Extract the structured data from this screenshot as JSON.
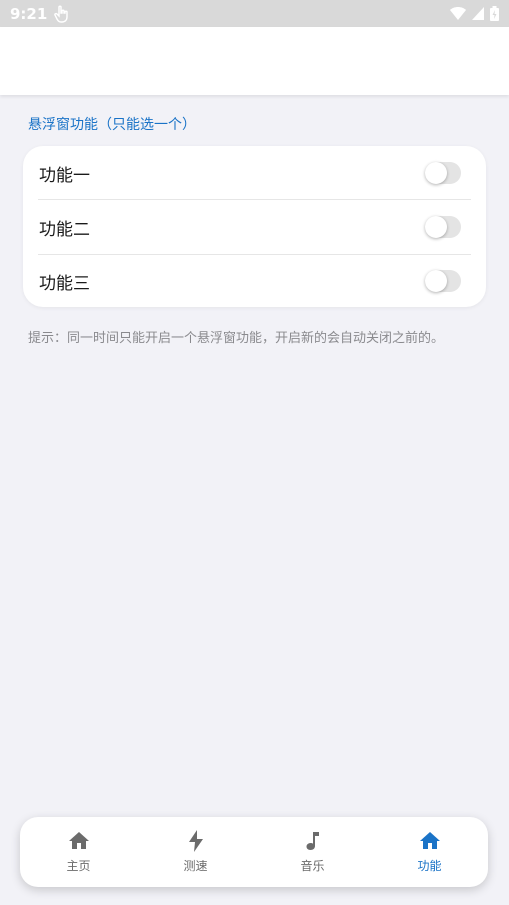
{
  "status_bar": {
    "time": "9:21",
    "icons": [
      "touch-icon",
      "wifi-icon",
      "signal-icon",
      "battery-icon"
    ]
  },
  "section_title": "悬浮窗功能（只能选一个）",
  "settings": [
    {
      "label": "功能一",
      "enabled": false
    },
    {
      "label": "功能二",
      "enabled": false
    },
    {
      "label": "功能三",
      "enabled": false
    }
  ],
  "hint": "提示：同一时间只能开启一个悬浮窗功能，开启新的会自动关闭之前的。",
  "tabs": [
    {
      "label": "主页",
      "icon": "home-icon",
      "active": false
    },
    {
      "label": "测速",
      "icon": "bolt-icon",
      "active": false
    },
    {
      "label": "音乐",
      "icon": "music-note-icon",
      "active": false
    },
    {
      "label": "功能",
      "icon": "home-icon",
      "active": true
    }
  ],
  "colors": {
    "accent": "#1a73c7",
    "background": "#f2f2f7",
    "inactive_tab": "#6b6b6b",
    "toggle_off": "#e4e4e4"
  }
}
